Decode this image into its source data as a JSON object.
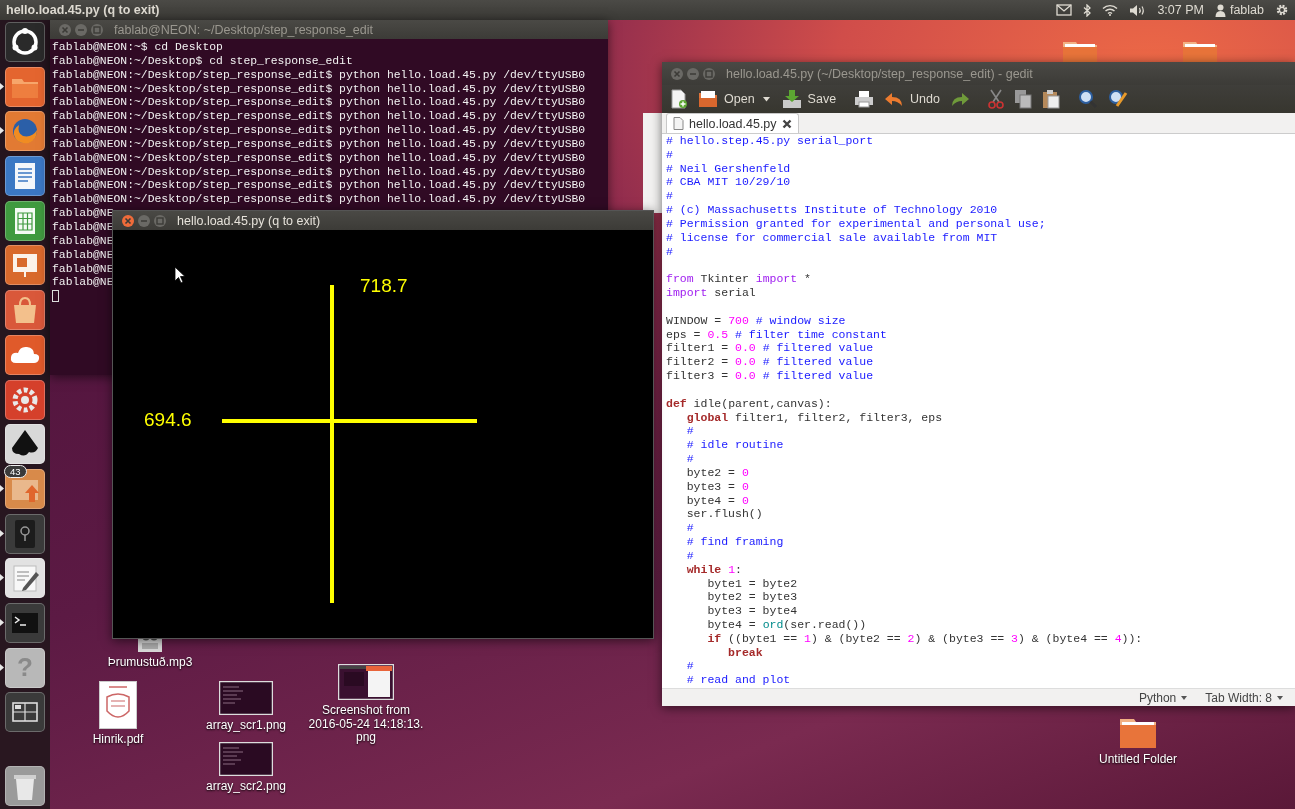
{
  "top_panel": {
    "title": "hello.load.45.py (q to exit)",
    "clock": "3:07 PM",
    "user": "fablab"
  },
  "launcher": [
    {
      "kind": "dash",
      "running": false
    },
    {
      "kind": "files",
      "running": true
    },
    {
      "kind": "browser",
      "running": true
    },
    {
      "kind": "writer",
      "running": false
    },
    {
      "kind": "calc",
      "running": false
    },
    {
      "kind": "impress",
      "running": false
    },
    {
      "kind": "software",
      "running": false
    },
    {
      "kind": "cloud",
      "running": false
    },
    {
      "kind": "settings",
      "running": false
    },
    {
      "kind": "vector",
      "running": false
    },
    {
      "kind": "update",
      "running": true,
      "badge": "43"
    },
    {
      "kind": "device",
      "running": true
    },
    {
      "kind": "editor",
      "running": true
    },
    {
      "kind": "terminal",
      "running": true
    },
    {
      "kind": "help",
      "running": true,
      "glyph": "?"
    },
    {
      "kind": "workspaces",
      "running": false
    },
    {
      "kind": "trash",
      "running": false
    }
  ],
  "desktop_icons": [
    {
      "kind": "folder",
      "label_lines": [
        "Untitled Folder"
      ]
    },
    {
      "kind": "audio",
      "label_lines": [
        "Þrumustuð.mp3"
      ]
    },
    {
      "kind": "pdf",
      "label_lines": [
        "Hinrik.pdf"
      ]
    },
    {
      "kind": "thumbnail",
      "label_lines": [
        "array_scr1.png"
      ]
    },
    {
      "kind": "thumbnail",
      "label_lines": [
        "array_scr2.png"
      ]
    },
    {
      "kind": "screenshot",
      "label_lines": [
        "Screenshot from",
        "2016-05-24 14:18:13.",
        "png"
      ]
    }
  ],
  "terminal": {
    "title": "fablab@NEON: ~/Desktop/step_response_edit",
    "active": false,
    "lines": [
      "fablab@NEON:~$ cd Desktop",
      "fablab@NEON:~/Desktop$ cd step_response_edit",
      "fablab@NEON:~/Desktop/step_response_edit$ python hello.load.45.py /dev/ttyUSB0",
      "fablab@NEON:~/Desktop/step_response_edit$ python hello.load.45.py /dev/ttyUSB0",
      "fablab@NEON:~/Desktop/step_response_edit$ python hello.load.45.py /dev/ttyUSB0",
      "fablab@NEON:~/Desktop/step_response_edit$ python hello.load.45.py /dev/ttyUSB0",
      "fablab@NEON:~/Desktop/step_response_edit$ python hello.load.45.py /dev/ttyUSB0",
      "fablab@NEON:~/Desktop/step_response_edit$ python hello.load.45.py /dev/ttyUSB0",
      "fablab@NEON:~/Desktop/step_response_edit$ python hello.load.45.py /dev/ttyUSB0",
      "fablab@NEON:~/Desktop/step_response_edit$ python hello.load.45.py /dev/ttyUSB0",
      "fablab@NEON:~/Desktop/step_response_edit$ python hello.load.45.py /dev/ttyUSB0",
      "fablab@NEON:~/Desktop/step_response_edit$ python hello.load.45.py /dev/ttyUSB0",
      "fablab@NE",
      "fablab@NE",
      "fablab@NE",
      "fablab@NE",
      "fablab@NE",
      "fablab@NE"
    ]
  },
  "plot_window": {
    "title": "hello.load.45.py (q to exit)",
    "active": true,
    "readings": [
      "718.7",
      "694.6"
    ]
  },
  "gedit": {
    "title": "hello.load.45.py (~/Desktop/step_response_edit) - gedit",
    "active": false,
    "toolbar": [
      {
        "kind": "new"
      },
      {
        "kind": "open",
        "label": "Open"
      },
      {
        "kind": "dropdown"
      },
      {
        "kind": "save",
        "label": "Save"
      },
      {
        "kind": "print"
      },
      {
        "kind": "undo",
        "label": "Undo"
      },
      {
        "kind": "redo"
      },
      {
        "kind": "cut"
      },
      {
        "kind": "copy"
      },
      {
        "kind": "paste"
      },
      {
        "kind": "find"
      },
      {
        "kind": "replace"
      }
    ],
    "tabs": [
      {
        "label": "hello.load.45.py",
        "selected": true
      }
    ],
    "code": [
      {
        "tokens": [
          {
            "text": "# hello.step.45.py serial_port",
            "kind": "comment"
          }
        ]
      },
      {
        "tokens": [
          {
            "text": "#",
            "kind": "comment"
          }
        ]
      },
      {
        "tokens": [
          {
            "text": "# Neil Gershenfeld",
            "kind": "comment"
          }
        ]
      },
      {
        "tokens": [
          {
            "text": "# CBA MIT 10/29/10",
            "kind": "comment"
          }
        ]
      },
      {
        "tokens": [
          {
            "text": "#",
            "kind": "comment"
          }
        ]
      },
      {
        "tokens": [
          {
            "text": "# (c) Massachusetts Institute of Technology 2010",
            "kind": "comment"
          }
        ]
      },
      {
        "tokens": [
          {
            "text": "# Permission granted for experimental and personal use;",
            "kind": "comment"
          }
        ]
      },
      {
        "tokens": [
          {
            "text": "# license for commercial sale available from MIT",
            "kind": "comment"
          }
        ]
      },
      {
        "tokens": [
          {
            "text": "#",
            "kind": "comment"
          }
        ]
      },
      {
        "kind": "blank"
      },
      {
        "tokens": [
          {
            "text": "from",
            "kind": "import"
          },
          {
            "text": " Tkinter ",
            "kind": "plain"
          },
          {
            "text": "import",
            "kind": "import"
          },
          {
            "text": " *",
            "kind": "plain"
          }
        ]
      },
      {
        "tokens": [
          {
            "text": "import",
            "kind": "import"
          },
          {
            "text": " serial",
            "kind": "plain"
          }
        ]
      },
      {
        "kind": "blank"
      },
      {
        "tokens": [
          {
            "text": "WINDOW = ",
            "kind": "plain"
          },
          {
            "text": "700",
            "kind": "number"
          },
          {
            "text": " # window size",
            "kind": "comment"
          }
        ]
      },
      {
        "tokens": [
          {
            "text": "eps = ",
            "kind": "plain"
          },
          {
            "text": "0.5",
            "kind": "number"
          },
          {
            "text": " # filter time constant",
            "kind": "comment"
          }
        ]
      },
      {
        "tokens": [
          {
            "text": "filter1 = ",
            "kind": "plain"
          },
          {
            "text": "0.0",
            "kind": "number"
          },
          {
            "text": " # filtered value",
            "kind": "comment"
          }
        ]
      },
      {
        "tokens": [
          {
            "text": "filter2 = ",
            "kind": "plain"
          },
          {
            "text": "0.0",
            "kind": "number"
          },
          {
            "text": " # filtered value",
            "kind": "comment"
          }
        ]
      },
      {
        "tokens": [
          {
            "text": "filter3 = ",
            "kind": "plain"
          },
          {
            "text": "0.0",
            "kind": "number"
          },
          {
            "text": " # filtered value",
            "kind": "comment"
          }
        ]
      },
      {
        "kind": "blank"
      },
      {
        "tokens": [
          {
            "text": "def",
            "kind": "statement"
          },
          {
            "text": " idle(parent,canvas):",
            "kind": "plain"
          }
        ]
      },
      {
        "tokens": [
          {
            "text": "   global",
            "kind": "statement"
          },
          {
            "text": " filter1, filter2, filter3, eps",
            "kind": "plain"
          }
        ]
      },
      {
        "tokens": [
          {
            "text": "   #",
            "kind": "comment"
          }
        ]
      },
      {
        "tokens": [
          {
            "text": "   # idle routine",
            "kind": "comment"
          }
        ]
      },
      {
        "tokens": [
          {
            "text": "   #",
            "kind": "comment"
          }
        ]
      },
      {
        "tokens": [
          {
            "text": "   byte2 = ",
            "kind": "plain"
          },
          {
            "text": "0",
            "kind": "number"
          }
        ]
      },
      {
        "tokens": [
          {
            "text": "   byte3 = ",
            "kind": "plain"
          },
          {
            "text": "0",
            "kind": "number"
          }
        ]
      },
      {
        "tokens": [
          {
            "text": "   byte4 = ",
            "kind": "plain"
          },
          {
            "text": "0",
            "kind": "number"
          }
        ]
      },
      {
        "tokens": [
          {
            "text": "   ser.flush()",
            "kind": "plain"
          }
        ]
      },
      {
        "tokens": [
          {
            "text": "   #",
            "kind": "comment"
          }
        ]
      },
      {
        "tokens": [
          {
            "text": "   # find framing",
            "kind": "comment"
          }
        ]
      },
      {
        "tokens": [
          {
            "text": "   #",
            "kind": "comment"
          }
        ]
      },
      {
        "tokens": [
          {
            "text": "   while ",
            "kind": "statement"
          },
          {
            "text": "1",
            "kind": "number"
          },
          {
            "text": ":",
            "kind": "plain"
          }
        ]
      },
      {
        "tokens": [
          {
            "text": "      byte1 = byte2",
            "kind": "plain"
          }
        ]
      },
      {
        "tokens": [
          {
            "text": "      byte2 = byte3",
            "kind": "plain"
          }
        ]
      },
      {
        "tokens": [
          {
            "text": "      byte3 = byte4",
            "kind": "plain"
          }
        ]
      },
      {
        "tokens": [
          {
            "text": "      byte4 = ",
            "kind": "plain"
          },
          {
            "text": "ord",
            "kind": "builtin"
          },
          {
            "text": "(ser.read())",
            "kind": "plain"
          }
        ]
      },
      {
        "tokens": [
          {
            "text": "      if",
            "kind": "statement"
          },
          {
            "text": " ((byte1 == ",
            "kind": "plain"
          },
          {
            "text": "1",
            "kind": "number"
          },
          {
            "text": ") & (byte2 == ",
            "kind": "plain"
          },
          {
            "text": "2",
            "kind": "number"
          },
          {
            "text": ") & (byte3 == ",
            "kind": "plain"
          },
          {
            "text": "3",
            "kind": "number"
          },
          {
            "text": ") & (byte4 == ",
            "kind": "plain"
          },
          {
            "text": "4",
            "kind": "number"
          },
          {
            "text": ")):",
            "kind": "plain"
          }
        ]
      },
      {
        "tokens": [
          {
            "text": "         break",
            "kind": "statement"
          }
        ]
      },
      {
        "tokens": [
          {
            "text": "   #",
            "kind": "comment"
          }
        ]
      },
      {
        "tokens": [
          {
            "text": "   # read and plot",
            "kind": "comment"
          }
        ]
      }
    ],
    "status_bar": {
      "language": "Python",
      "tab_width": "Tab Width: 8"
    }
  }
}
